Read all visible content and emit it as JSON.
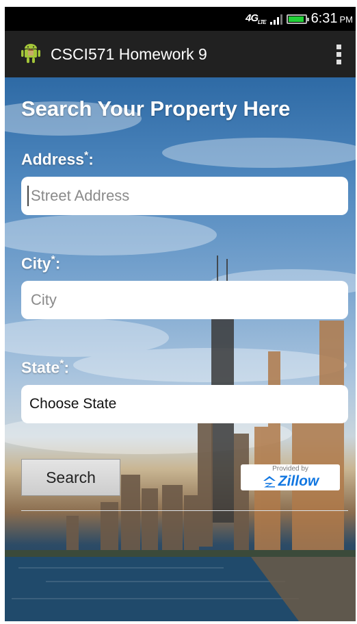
{
  "status_bar": {
    "network": "4G",
    "network_sub": "LTE",
    "time": "6:31",
    "ampm": "PM",
    "battery_level": 0.9
  },
  "action_bar": {
    "app_icon": "android-robot-icon",
    "title": "CSCI571 Homework 9",
    "menu_icon": "overflow-menu-icon"
  },
  "form": {
    "heading": "Search Your Property Here",
    "address": {
      "label": "Address",
      "required_mark": "*",
      "suffix": ":",
      "value": "",
      "placeholder": "Street Address"
    },
    "city": {
      "label": "City",
      "required_mark": "*",
      "suffix": ":",
      "value": "",
      "placeholder": "City"
    },
    "state": {
      "label": "State",
      "required_mark": "*",
      "suffix": ":",
      "selected": "Choose State"
    },
    "search_label": "Search"
  },
  "zillow": {
    "provided_by": "Provided by",
    "logo_text": "Zillow"
  },
  "colors": {
    "action_bar": "#212121",
    "battery": "#22d038",
    "zillow_blue": "#1277e1",
    "android_green": "#a4c639"
  }
}
